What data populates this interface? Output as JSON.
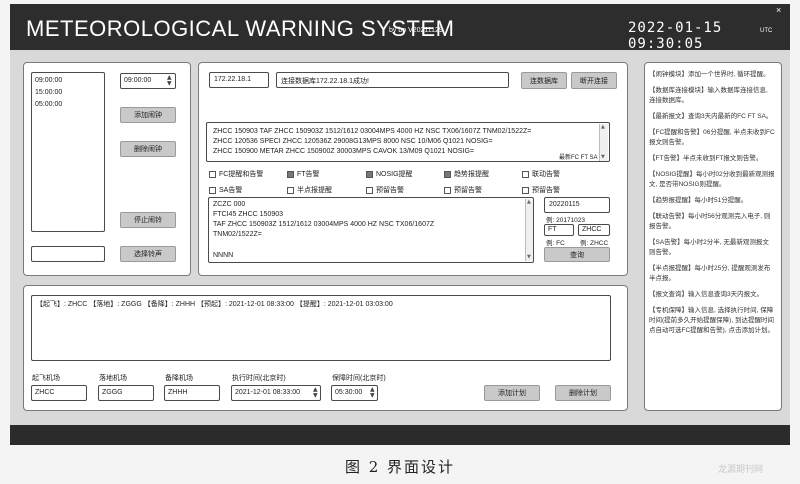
{
  "title_bar": {
    "app_title": "METEOROLOGICAL WARNING SYSTEM",
    "version": "by bo V20211129",
    "clock": "2022-01-15 09:30:05",
    "clock_suffix": "UTC",
    "close_icon": "×"
  },
  "alarm_panel": {
    "times_list": [
      "09:00:00",
      "15:00:00",
      "05:00:00"
    ],
    "time_picker_value": "09:00:00",
    "add_alarm_label": "添加闹钟",
    "delete_alarm_label": "删除闹钟",
    "stop_alarm_label": "停止闹铃",
    "sound_path_value": "",
    "choose_sound_label": "选择铃声"
  },
  "connection": {
    "ip_value": "172.22.18.1",
    "status_message": "连接数据库172.22.18.1成功!",
    "connect_label": "连数据库",
    "disconnect_label": "断开连接"
  },
  "reports": {
    "latest_lines": [
      "ZHCC 150903 TAF ZHCC 150903Z 1512/1612 03004MPS 4000 HZ NSC TX06/1607Z TNM02/1522Z=",
      "ZHCC 120536 SPECI ZHCC 120536Z 29008G13MPS 8000 NSC 10/M06 Q1021 NOSIG=",
      "ZHCC 150900 METAR ZHCC 150900Z 30003MPS CAVOK 13/M09 Q1021 NOSIG="
    ],
    "latest_tag": "最新FC FT SA"
  },
  "options": {
    "row1": [
      {
        "label": "FC提醒和告警",
        "checked": false
      },
      {
        "label": "FT告警",
        "checked": true
      },
      {
        "label": "NOSIG提醒",
        "checked": true
      },
      {
        "label": "趋势报提醒",
        "checked": true
      },
      {
        "label": "联动告警",
        "checked": false
      }
    ],
    "row2": [
      {
        "label": "SA告警",
        "checked": false
      },
      {
        "label": "半点报提醒",
        "checked": false
      },
      {
        "label": "预留告警",
        "checked": false
      },
      {
        "label": "预留告警",
        "checked": false
      },
      {
        "label": "预留告警",
        "checked": false
      }
    ]
  },
  "message": {
    "lines": [
      "ZCZC 000",
      "FTCI45 ZHCC 150903",
      "TAF ZHCC 150903Z 1512/1612 03004MPS 4000 HZ NSC TX06/1607Z",
      "TNM02/1522Z=",
      "",
      "NNNN"
    ]
  },
  "query": {
    "date_value": "20220115",
    "date_example": "例: 20171023",
    "type_value": "FT",
    "station_value": "ZHCC",
    "type_example": "例: FC",
    "station_example": "例: ZHCC",
    "query_label": "查询"
  },
  "plan_output": {
    "line": "【起飞】: ZHCC    【落地】: ZGGG    【备降】: ZHHH    【预起】: 2021-12-01 08:33:00    【提醒】: 2021-12-01 03:03:00"
  },
  "plan_form": {
    "dep_label": "起飞机场",
    "dep_value": "ZHCC",
    "arr_label": "落地机场",
    "arr_value": "ZGGG",
    "alt_label": "备降机场",
    "alt_value": "ZHHH",
    "exec_label": "执行时间(北京时)",
    "exec_value": "2021-12-01 08:33:00",
    "hold_label": "保障时间(北京时)",
    "hold_value": "05:30:00",
    "add_plan_label": "添加计划",
    "delete_plan_label": "删除计划"
  },
  "help_notes": [
    "【闹钟模块】添加一个世界时, 循环提醒。",
    "【数据库连接模块】输入数据库连接信息, 连接数据库。",
    "【最新报文】查询3天内最新的FC FT SA。",
    "【FC提醒和告警】06分提醒, 半点未收到FC报文则告警。",
    "【FT告警】半点未收到FT报文则告警。",
    "【NOSIG提醒】每小时02分收到最新观测报文, 是否带NOSIG则提醒。",
    "【趋势报提醒】每小时51分提醒。",
    "【联动告警】每小时56分观测完入电子, 则报告警。",
    "【SA告警】每小时2分半, 无最新观测报文则告警。",
    "【半点报提醒】每小时25分, 提醒观测发布半点报。",
    "【报文查询】输入信息查询3天内报文。",
    "【专机保障】输入信息, 选择执行时间, 保障时间(提前多久开始提醒保障), 到达提醒时间点自动可选FC提醒和告警), 点击添加计划。"
  ],
  "caption": "图 2   界面设计",
  "watermark": "龙源期刊网"
}
